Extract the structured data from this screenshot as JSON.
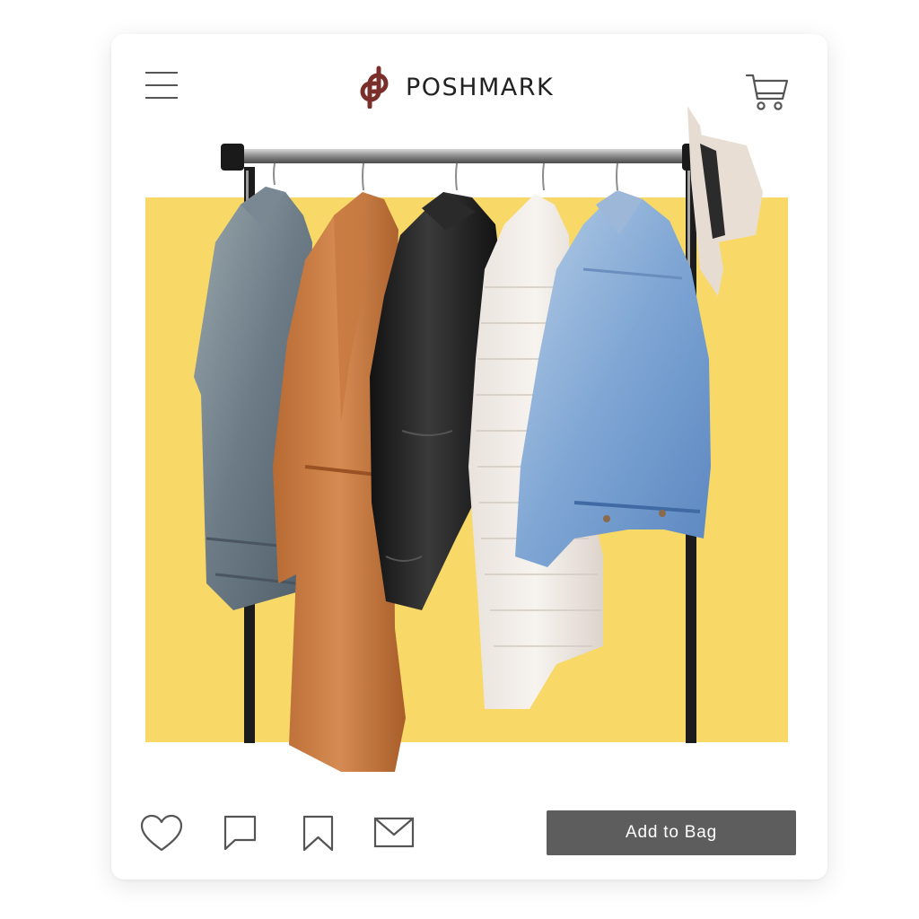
{
  "brand": {
    "name": "POSHMARK",
    "logo_color": "#7a2f2a"
  },
  "header": {
    "menu_icon": "hamburger-menu-icon",
    "cart_icon": "shopping-cart-icon"
  },
  "listing": {
    "image_description_icon": "clothing-rack-photo",
    "backdrop_color": "#f8d968"
  },
  "actions": {
    "like_icon": "heart-icon",
    "comment_icon": "comment-icon",
    "bookmark_icon": "bookmark-icon",
    "share_icon": "envelope-icon",
    "add_to_bag_label": "Add to Bag",
    "button_color": "#5d5d5d"
  }
}
